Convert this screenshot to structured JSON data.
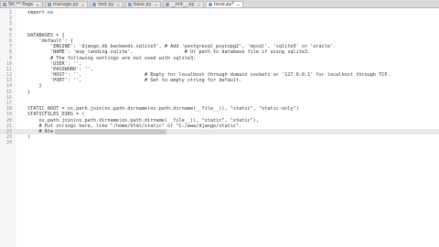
{
  "tabs": [
    {
      "icon": "file-icon",
      "label": "Stt.** Page",
      "active": false
    },
    {
      "icon": "file-icon",
      "label": "manage.py",
      "active": false
    },
    {
      "icon": "file-icon",
      "label": "test.py",
      "active": false
    },
    {
      "icon": "file-icon",
      "label": "base.py",
      "active": false
    },
    {
      "icon": "file-icon",
      "label": "__init__.py",
      "active": false
    },
    {
      "icon": "file-icon",
      "label": "local.py*",
      "active": true
    }
  ],
  "editor": {
    "lines": [
      {
        "n": "1",
        "code": "import os"
      },
      {
        "n": "2",
        "code": ""
      },
      {
        "n": "3",
        "code": ""
      },
      {
        "n": "4",
        "code": ""
      },
      {
        "n": "5",
        "code": "DATABASES = {"
      },
      {
        "n": "6",
        "code": "    'default': {"
      },
      {
        "n": "7",
        "code": "        'ENGINE': 'django.db.backends.sqlite3', # Add 'postgresql_psycopg2', 'mysql', 'sqlite3' or 'oracle'."
      },
      {
        "n": "8",
        "code": "        'NAME': 'mvp_landing.sqlite',                  # Or path to database file if using sqlite3."
      },
      {
        "n": "9",
        "code": "        # The following settings are not used with sqlite3:"
      },
      {
        "n": "10",
        "code": "        'USER': '',"
      },
      {
        "n": "11",
        "code": "        'PASSWORD': '',"
      },
      {
        "n": "12",
        "code": "        'HOST': '',                      # Empty for localhost through domain sockets or '127.0.0.1' for localhost through TCP."
      },
      {
        "n": "13",
        "code": "        'PORT': '',                      # Set to empty string for default."
      },
      {
        "n": "14",
        "code": "    }"
      },
      {
        "n": "15",
        "code": "}"
      },
      {
        "n": "16",
        "code": ""
      },
      {
        "n": "17",
        "code": ""
      },
      {
        "n": "18",
        "code": "STATIC_ROOT = os.path.join(os.path.dirname(os.path.dirname(__file__)), \"static\", \"static-only\")"
      },
      {
        "n": "19",
        "code": "STATICFILES_DIRS = ("
      },
      {
        "n": "20",
        "code": "    os.path.join(os.path.dirname(os.path.dirname(__file__)), \"static\", \"static\"),"
      },
      {
        "n": "21",
        "code": "    # Put strings here, like \"/home/html/static\" or \"C:/www/django/static\"."
      },
      {
        "n": "22",
        "code": "    # Alw"
      },
      {
        "n": "23",
        "code": ")"
      },
      {
        "n": "24",
        "code": ""
      }
    ],
    "current_line": "22"
  },
  "colors": {
    "keyword": "#7a3e9d",
    "string": "#3a7a2a",
    "comment": "#777777",
    "selection": "#c8c8c8"
  }
}
